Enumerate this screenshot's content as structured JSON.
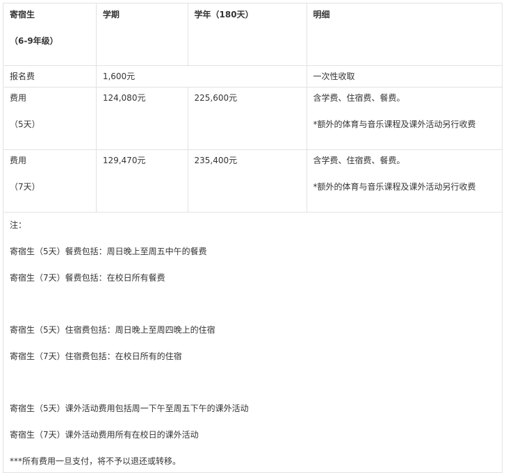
{
  "table": {
    "headers": {
      "boarder_line1": "寄宿生",
      "boarder_line2": "（6-9年级）",
      "semester": "学期",
      "year": "学年（180天）",
      "details": "明细"
    },
    "registration": {
      "label": "报名费",
      "amount": "1,600元",
      "detail": "一次性收取"
    },
    "fee_rows": [
      {
        "label": "费用",
        "sub": "（5天）",
        "semester": "124,080元",
        "year": "225,600元",
        "detail_line1": "含学费、住宿费、餐费。",
        "detail_line2": "*额外的体育与音乐课程及课外活动另行收费"
      },
      {
        "label": "费用",
        "sub": "（7天）",
        "semester": "129,470元",
        "year": "235,400元",
        "detail_line1": "含学费、住宿费、餐费。",
        "detail_line2": "*额外的体育与音乐课程及课外活动另行收费"
      }
    ],
    "notes": {
      "title": "注：",
      "meal_5": "寄宿生（5天）餐费包括：周日晚上至周五中午的餐费",
      "meal_7": "寄宿生（7天）餐费包括：在校日所有餐费",
      "lodging_5": "寄宿生（5天）住宿费包括：周日晚上至周四晚上的住宿",
      "lodging_7": "寄宿生（7天）住宿费包括：在校日所有的住宿",
      "activity_5": "寄宿生（5天）课外活动费用包括周一下午至周五下午的课外活动",
      "activity_7": "寄宿生（7天）课外活动费用所有在校日的课外活动",
      "final": "***所有费用一旦支付，将不予以退还或转移。"
    }
  }
}
